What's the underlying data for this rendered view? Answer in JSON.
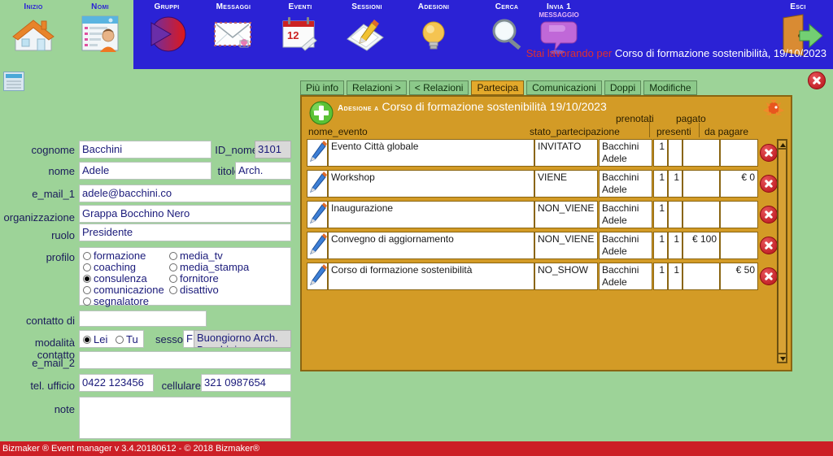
{
  "toolbar": {
    "items": [
      {
        "label": "Inizio",
        "icon": "home-icon",
        "active": false
      },
      {
        "label": "Nomi",
        "icon": "contact-card-icon",
        "active": true
      },
      {
        "label": "Gruppi",
        "icon": "pie-chart-icon",
        "active": false
      },
      {
        "label": "Messaggi",
        "icon": "envelope-icon",
        "active": false
      },
      {
        "label": "Eventi",
        "icon": "calendar-icon",
        "active": false
      },
      {
        "label": "Sessioni",
        "icon": "notepad-pencil-icon",
        "active": false
      },
      {
        "label": "Adesioni",
        "icon": "lightbulb-icon",
        "active": false
      }
    ],
    "search_label": "Cerca",
    "search_icon": "magnifier-icon",
    "send_label": "Invia 1",
    "send_sublabel": "MESSAGGIO",
    "send_icon": "speech-bubble-icon",
    "exit_label": "Esci",
    "exit_icon": "exit-door-icon",
    "working_prefix": "Stai lavorando per",
    "working_value": "Corso di formazione sostenibilità, 19/10/2023"
  },
  "colors": {
    "toolbar_blue": "#2b22d5",
    "page_green": "#9dd398",
    "panel_orange": "#d39b26",
    "tab_green": "#8cc98a",
    "tab_selected": "#e3a92b",
    "footer_red": "#cc1f26",
    "working_red": "#e03030"
  },
  "form": {
    "doc_icon": "document-list-icon",
    "close_icon": "close-circle-icon",
    "fields": {
      "cognome_label": "cognome",
      "cognome_value": "Bacchini",
      "id_nome_label": "ID_nome",
      "id_nome_value": "3101",
      "nome_label": "nome",
      "nome_value": "Adele",
      "titolo_label": "titolo",
      "titolo_value": "Arch.",
      "email1_label": "e_mail_1",
      "email1_value": "adele@bacchini.co",
      "organizzazione_label": "organizzazione",
      "organizzazione_value": "Grappa Bocchino Nero",
      "ruolo_label": "ruolo",
      "ruolo_value": "Presidente",
      "profilo_label": "profilo",
      "contatto_di_label": "contatto di",
      "contatto_di_value": "",
      "modalita_label": "modalità contatto",
      "sesso_label": "sesso",
      "sesso_value": "F",
      "greeting_value": "Buongiorno Arch. Bacchini",
      "email2_label": "e_mail_2",
      "email2_value": "",
      "tel_ufficio_label": "tel. ufficio",
      "tel_ufficio_value": "0422 123456",
      "cellulare_label": "cellulare",
      "cellulare_value": "321 0987654",
      "note_label": "note",
      "note_value": ""
    },
    "profilo_options_left": [
      {
        "label": "formazione",
        "selected": false
      },
      {
        "label": "coaching",
        "selected": false
      },
      {
        "label": "consulenza",
        "selected": true
      },
      {
        "label": "comunicazione",
        "selected": false
      },
      {
        "label": "segnalatore",
        "selected": false
      }
    ],
    "profilo_options_right": [
      {
        "label": "media_tv",
        "selected": false
      },
      {
        "label": "media_stampa",
        "selected": false
      },
      {
        "label": "fornitore",
        "selected": false
      },
      {
        "label": "disattivo",
        "selected": false
      }
    ],
    "modalita_options": [
      {
        "label": "Lei",
        "selected": true
      },
      {
        "label": "Tu",
        "selected": false
      }
    ]
  },
  "tabs": [
    {
      "label": "Più info",
      "selected": false
    },
    {
      "label": "Relazioni >",
      "selected": false
    },
    {
      "label": "< Relazioni",
      "selected": false
    },
    {
      "label": "Partecipa",
      "selected": true
    },
    {
      "label": "Comunicazioni",
      "selected": false
    },
    {
      "label": "Doppi",
      "selected": false
    },
    {
      "label": "Modifiche",
      "selected": false
    }
  ],
  "panel": {
    "add_icon": "plus-circle-icon",
    "sun_icon": "sun-icon",
    "title_prefix": "Adesione a",
    "title_value": "Corso di formazione sostenibilità 19/10/2023",
    "headers": {
      "nome_evento": "nome_evento",
      "stato_partecipazione": "stato_partecipazione",
      "prenotati": "prenotati",
      "pagato": "pagato",
      "presenti": "presenti",
      "da_pagare": "da pagare"
    },
    "edit_icon": "pencil-icon",
    "delete_icon": "delete-circle-icon",
    "rows": [
      {
        "nome_evento": "Evento Città globale",
        "stato": "INVITATO",
        "nome": "Bacchini Adele",
        "prenotati": "1",
        "presenti": "",
        "pagato": "",
        "da_pagare": ""
      },
      {
        "nome_evento": "Workshop",
        "stato": "VIENE",
        "nome": "Bacchini Adele",
        "prenotati": "1",
        "presenti": "1",
        "pagato": "",
        "da_pagare": "€ 0"
      },
      {
        "nome_evento": "Inaugurazione",
        "stato": "NON_VIENE",
        "nome": "Bacchini Adele",
        "prenotati": "1",
        "presenti": "",
        "pagato": "",
        "da_pagare": ""
      },
      {
        "nome_evento": "Convegno di aggiornamento",
        "stato": "NON_VIENE",
        "nome": "Bacchini Adele",
        "prenotati": "1",
        "presenti": "1",
        "pagato": "€ 100",
        "da_pagare": ""
      },
      {
        "nome_evento": "Corso di formazione sostenibilità",
        "stato": "NO_SHOW",
        "nome": "Bacchini Adele",
        "prenotati": "1",
        "presenti": "1",
        "pagato": "",
        "da_pagare": "€ 50"
      }
    ]
  },
  "footer": {
    "text": "Bizmaker ® Event manager v 3.4.20180612 - © 2018 Bizmaker®"
  }
}
